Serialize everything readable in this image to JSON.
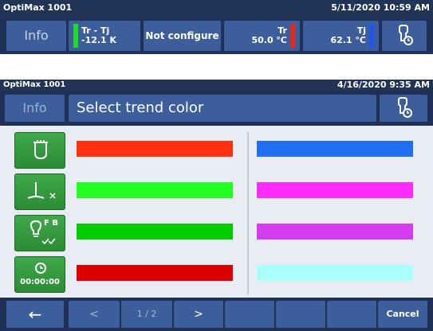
{
  "top": {
    "device": "OptiMax 1001",
    "datetime": "5/11/2020 10:59 AM",
    "info_label": "Info",
    "trtj": {
      "label": "Tr - Tj",
      "value": "-12.1 K",
      "color": "#1fdc2a"
    },
    "not_configured": "Not configure",
    "tr": {
      "label": "Tr",
      "value": "50.0 °C",
      "color": "#e12b1c"
    },
    "tj": {
      "label": "Tj",
      "value": "62.1 °C",
      "color": "#1f57e6"
    }
  },
  "screen": {
    "device": "OptiMax 1001",
    "datetime": "4/16/2020 9:35 AM",
    "info_label": "Info",
    "title": "Select trend color"
  },
  "sidebar": [
    {
      "name": "reactor-icon",
      "label": ""
    },
    {
      "name": "stirrer-icon",
      "label": ""
    },
    {
      "name": "lamp-icon",
      "label": "F B"
    },
    {
      "name": "timer-icon",
      "label": "00:00:00"
    }
  ],
  "colors": {
    "left": [
      "#ff3010",
      "#20ff20",
      "#00cc00",
      "#dd0000"
    ],
    "right": [
      "#1f6ff0",
      "#ff2cff",
      "#d43cf0",
      "#a8fffc"
    ]
  },
  "footer": {
    "back": "←",
    "prev": "<",
    "page": "1 / 2",
    "next": ">",
    "cancel": "Cancel"
  }
}
